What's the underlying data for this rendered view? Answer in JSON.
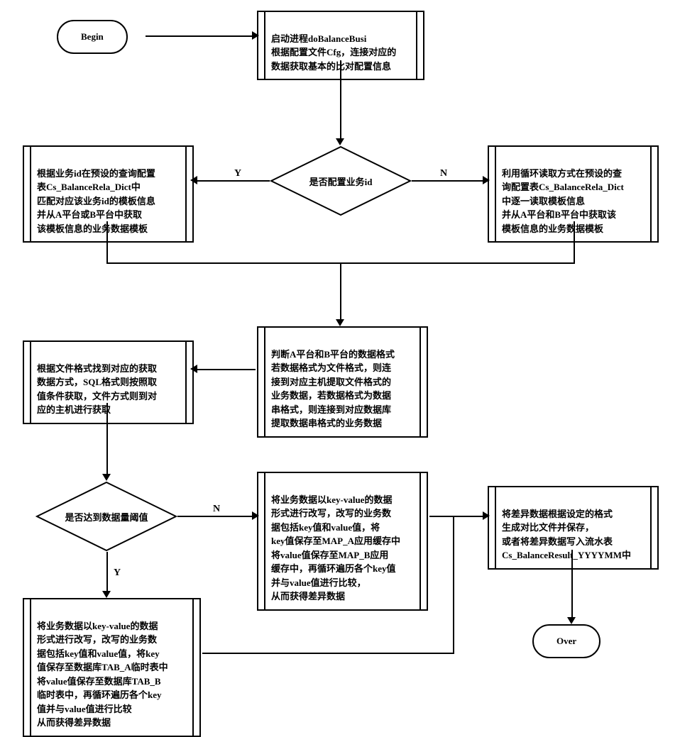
{
  "terminators": {
    "begin": "Begin",
    "over": "Over"
  },
  "processes": {
    "startProc": "启动进程doBalanceBusi\n根据配置文件Cfg，连接对应的\n数据获取基本的比对配置信息",
    "yBranch": "根据业务id在预设的查询配置\n表Cs_BalanceRela_Dict中\n匹配对应该业务id的模板信息\n并从A平台或B平台中获取\n该模板信息的业务数据模板",
    "nBranch": "利用循环读取方式在预设的查\n询配置表Cs_BalanceRela_Dict\n中逐一读取模板信息\n并从A平台和B平台中获取该\n模板信息的业务数据模板",
    "judgeFmt": "判断A平台和B平台的数据格式\n若数据格式为文件格式，则连\n接到对应主机提取文件格式的\n业务数据，若数据格式为数据\n串格式，则连接到对应数据库\n提取数据串格式的业务数据",
    "fileFmt": "根据文件格式找到对应的获取\n数据方式，SQL格式则按照取\n值条件获取，文件方式则到对\n应的主机进行获取",
    "thresholdN": "将业务数据以key-value的数据\n形式进行改写，改写的业务数\n据包括key值和value值，将\nkey值保存至MAP_A应用缓存中\n将value值保存至MAP_B应用\n缓存中，再循环遍历各个key值\n并与value值进行比较，\n从而获得差异数据",
    "thresholdY": "将业务数据以key-value的数据\n形式进行改写，改写的业务数\n据包括key值和value值，将key\n值保存至数据库TAB_A临时表中\n将value值保存至数据库TAB_B\n临时表中，再循环遍历各个key\n值并与value值进行比较\n从而获得差异数据",
    "output": "将差异数据根据设定的格式\n生成对比文件并保存，\n或者将差异数据写入流水表\nCs_BalanceResult_YYYYMM中"
  },
  "decisions": {
    "bizId": "是否配置业务id",
    "threshold": "是否达到数据量阈值"
  },
  "labels": {
    "yes": "Y",
    "no": "N"
  }
}
